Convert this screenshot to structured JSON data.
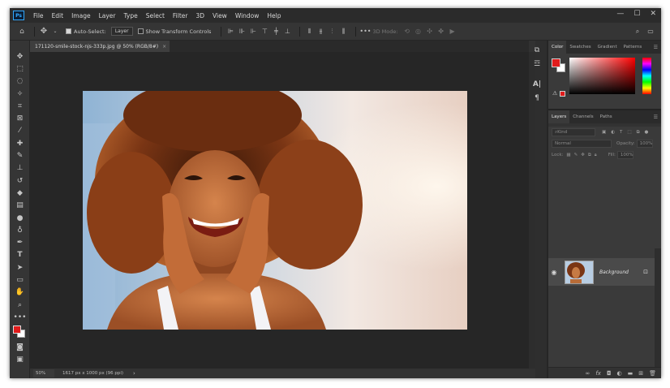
{
  "app": {
    "logo": "Ps"
  },
  "menu": [
    "File",
    "Edit",
    "Image",
    "Layer",
    "Type",
    "Select",
    "Filter",
    "3D",
    "View",
    "Window",
    "Help"
  ],
  "window_controls": {
    "minimize": "—",
    "maximize": "☐",
    "close": "✕"
  },
  "options": {
    "home_icon": "home-icon",
    "auto_select_label": "Auto-Select:",
    "auto_select_checked": true,
    "auto_select_target": "Layer",
    "show_transform_label": "Show Transform Controls",
    "show_transform_checked": false,
    "mode_3d_label": "3D Mode:"
  },
  "document": {
    "tab_title": "171120-smile-stock-njs-333p.jpg @ 50% (RGB/8#)",
    "tab_close": "×"
  },
  "status": {
    "zoom": "50%",
    "info": "1617 px x 1000 px (96 ppi)",
    "arrow": "›"
  },
  "panels": {
    "color_tabs": [
      "Color",
      "Swatches",
      "Gradient",
      "Patterns"
    ],
    "color_active": "Color",
    "foreground_color": "#e01b1b",
    "background_color": "#ffffff",
    "layers_tabs": [
      "Layers",
      "Channels",
      "Paths"
    ],
    "layers_active": "Layers",
    "filter_placeholder": "Kind",
    "blend_mode": "Normal",
    "opacity_label": "Opacity:",
    "opacity_value": "100%",
    "lock_label": "Lock:",
    "fill_label": "Fill:",
    "fill_value": "100%",
    "layers": [
      {
        "name": "Background",
        "visible": true,
        "locked": true
      }
    ]
  },
  "colors": {
    "accent": "#31a8ff",
    "chrome": "#323232",
    "canvas": "#262626"
  }
}
